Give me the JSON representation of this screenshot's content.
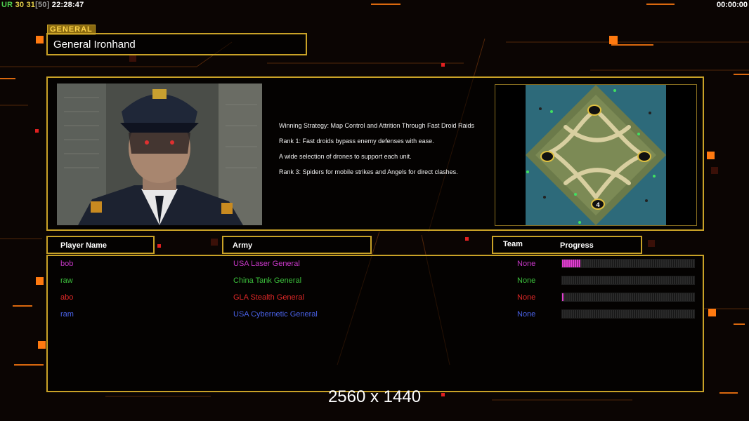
{
  "hud": {
    "ur_label": "UR",
    "val1": "30",
    "val2": "31",
    "val3": "[50]",
    "clock": "22:28:47",
    "timer": "00:00:00"
  },
  "general": {
    "tag": "GENERAL",
    "name": "General Ironhand",
    "description": [
      "Winning Strategy: Map Control and Attrition Through Fast Droid Raids",
      "Rank 1: Fast droids bypass enemy defenses with ease.",
      "A wide selection of drones to support each unit.",
      "Rank 3: Spiders for mobile strikes and Angels for direct clashes."
    ]
  },
  "map": {
    "start_marker_label": "4"
  },
  "table": {
    "headers": {
      "player_name": "Player Name",
      "army": "Army",
      "team": "Team",
      "progress": "Progress"
    },
    "rows": [
      {
        "name": "bob",
        "army": "USA Laser General",
        "team": "None",
        "color": "#c838c8",
        "progress": 0.14
      },
      {
        "name": "raw",
        "army": "China Tank General",
        "team": "None",
        "color": "#3cc03c",
        "progress": 0.0
      },
      {
        "name": "abo",
        "army": "GLA Stealth General",
        "team": "None",
        "color": "#e02828",
        "progress": 0.01
      },
      {
        "name": "ram",
        "army": "USA Cybernetic General",
        "team": "None",
        "color": "#4a62e8",
        "progress": 0.0
      }
    ]
  },
  "resolution": "2560 x 1440",
  "colors": {
    "gold": "#c9a227",
    "accent_orange": "#ff7a10"
  }
}
